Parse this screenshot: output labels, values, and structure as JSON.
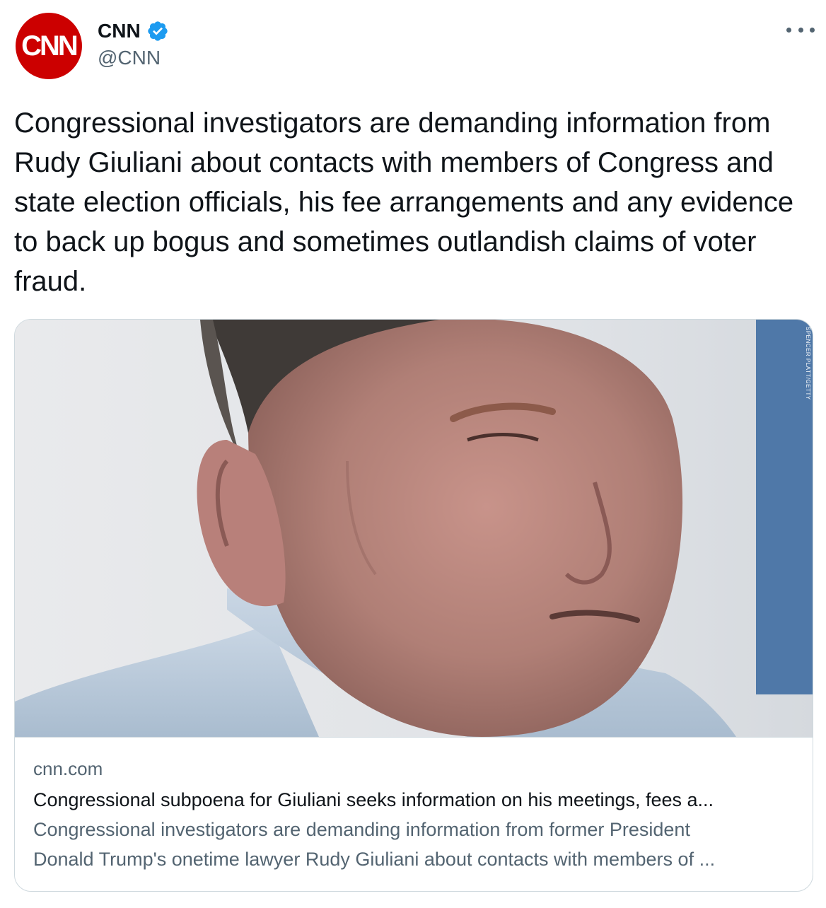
{
  "author": {
    "name": "CNN",
    "handle": "@CNN",
    "avatar_logo": "CNN",
    "verified": true
  },
  "tweet": {
    "text": "Congressional investigators are demanding information from Rudy Giuliani about contacts with members of Congress and state election officials, his fee arrangements and any evidence to back up bogus and sometimes outlandish claims of voter fraud."
  },
  "card": {
    "image_credit": "SPENCER PLATT/GETTY",
    "domain": "cnn.com",
    "title": "Congressional subpoena for Giuliani seeks information on his meetings, fees a...",
    "description_line1": "Congressional investigators are demanding information from former President",
    "description_line2": "Donald Trump's onetime lawyer Rudy Giuliani about contacts with members of ..."
  },
  "icons": {
    "verified": "verified-badge-icon",
    "more": "more-options-icon"
  },
  "colors": {
    "brand_red": "#cc0000",
    "verified_blue": "#1d9bf0",
    "secondary_text": "#536471",
    "primary_text": "#0f1419",
    "border": "#cfd9de"
  }
}
